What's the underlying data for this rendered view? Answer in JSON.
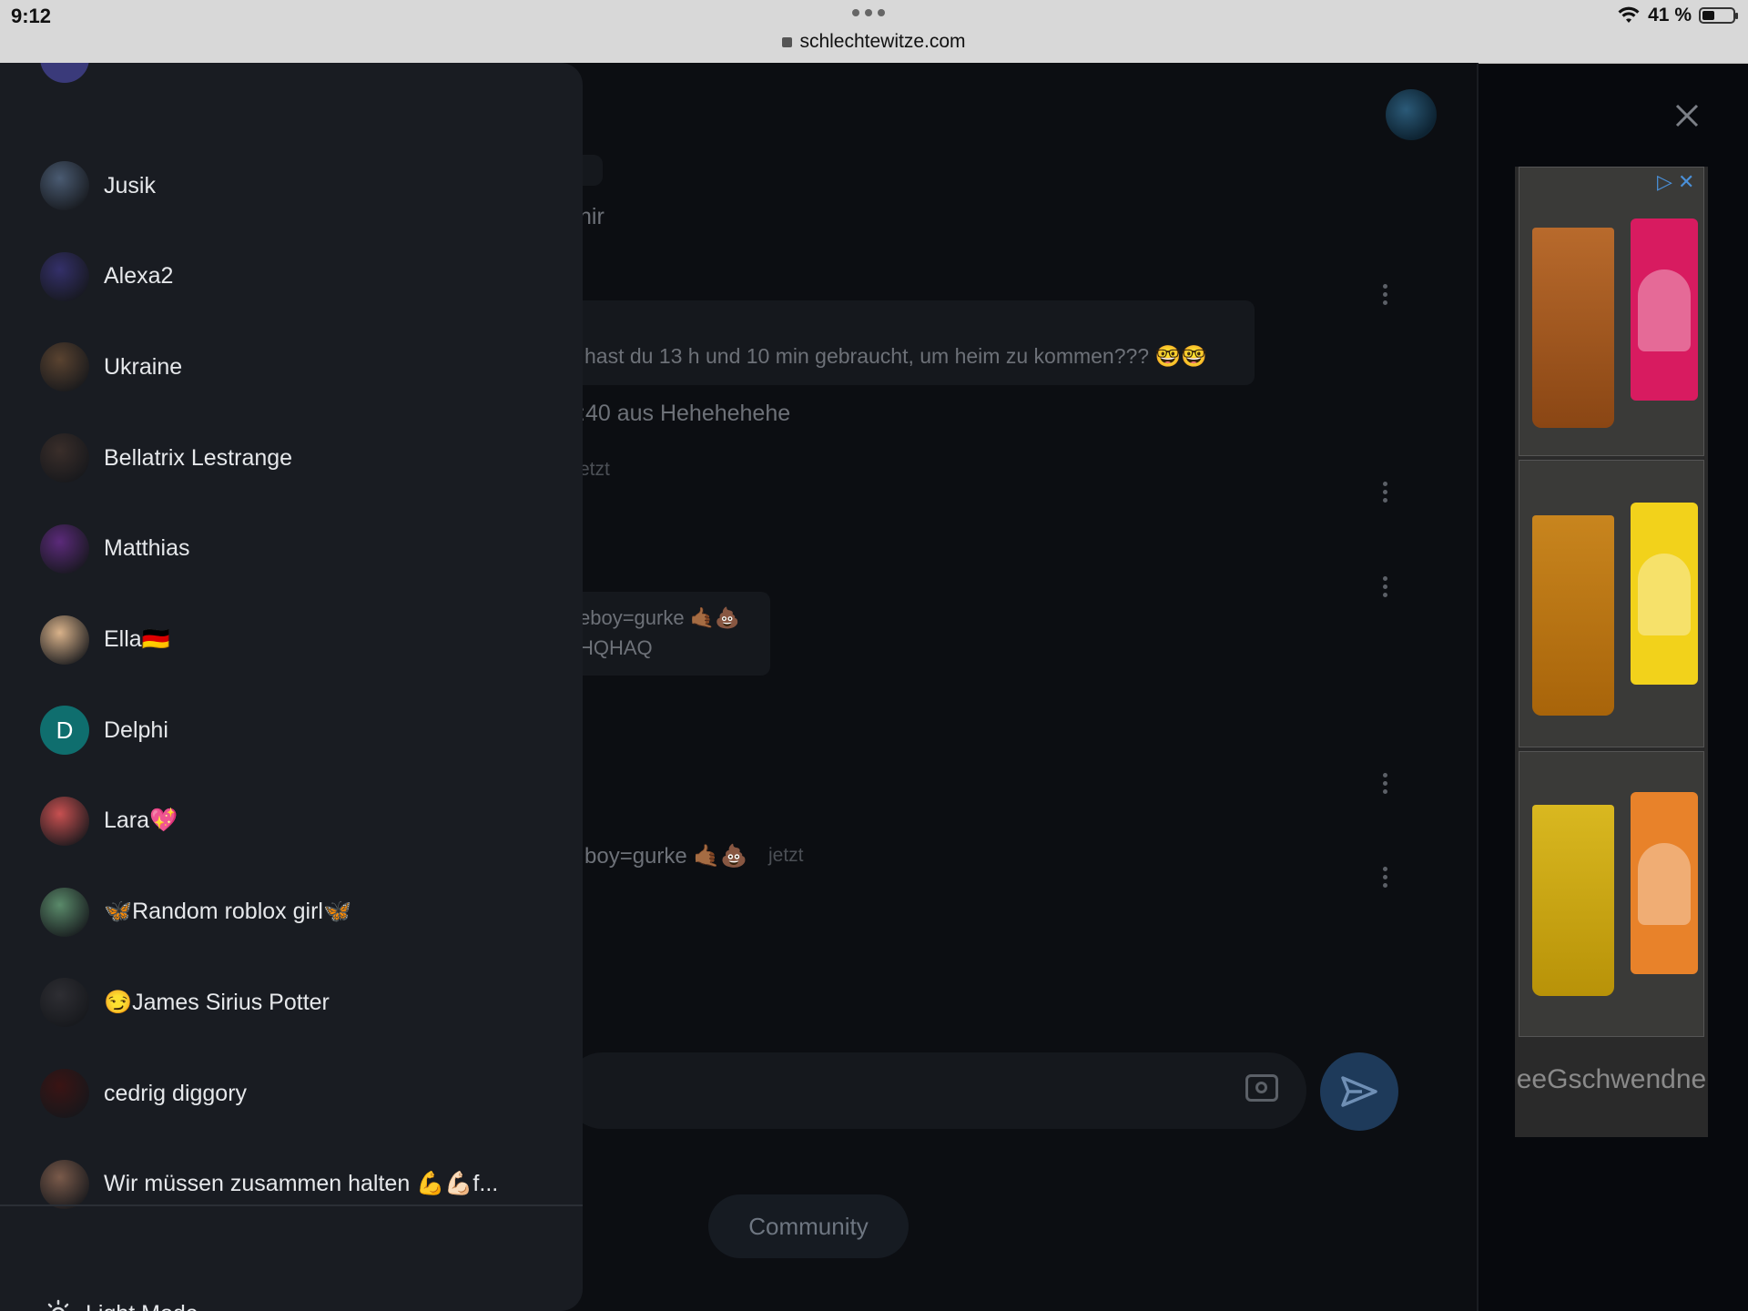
{
  "status_bar": {
    "time": "9:12",
    "url": "schlechtewitze.com",
    "battery": "41 %",
    "battery_level": 0.41
  },
  "chat_background": {
    "lines": [
      "nir",
      "hast du 13 h und 10 min gebraucht, um heim zu kommen??? 🤓🤓",
      ":40 aus Hehehehehe",
      "etzt",
      "eboy=gurke 🤙🏾💩",
      "HQHAQ",
      "boy=gurke 🤙🏾💩",
      "jetzt"
    ],
    "community_label": "Community"
  },
  "ad": {
    "text": "eeGschwendne",
    "colors": {
      "cherry": "#d81b60",
      "lemon": "#f2d21b",
      "peach": "#e8822a"
    }
  },
  "drawer": {
    "contacts": [
      {
        "name": "Jusik",
        "avatar": "photo",
        "color": "#4a5b72"
      },
      {
        "name": "Alexa2",
        "avatar": "photo",
        "color": "#34306a"
      },
      {
        "name": "Ukraine",
        "avatar": "photo",
        "color": "#5a4330"
      },
      {
        "name": "Bellatrix Lestrange",
        "avatar": "photo",
        "color": "#3a2e2a"
      },
      {
        "name": "Matthias",
        "avatar": "photo",
        "color": "#5b2a7a"
      },
      {
        "name": "Ella🇩🇪",
        "avatar": "photo",
        "color": "#d9b28a"
      },
      {
        "name": "Delphi",
        "avatar": "letter",
        "letter": "D",
        "color": "#0f6e6e"
      },
      {
        "name": "Lara💖",
        "avatar": "photo",
        "color": "#c75050"
      },
      {
        "name": "🦋Random roblox girl🦋",
        "avatar": "photo",
        "color": "#5a8a6a"
      },
      {
        "name": "😏James Sirius Potter",
        "avatar": "photo",
        "color": "#2e2e33"
      },
      {
        "name": "cedrig diggory",
        "avatar": "photo",
        "color": "#3a1414"
      },
      {
        "name": "Wir müssen zusammen halten 💪💪🏻f...",
        "avatar": "photo",
        "color": "#7a5a4a"
      }
    ],
    "light_mode_label": "Light Mode",
    "icons": {
      "light_mode": "sun-icon"
    }
  }
}
